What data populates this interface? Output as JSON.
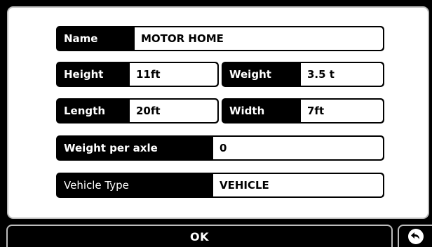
{
  "vehicle_profile": {
    "name": {
      "label": "Name",
      "value": "MOTOR HOME"
    },
    "height": {
      "label": "Height",
      "value": "11ft"
    },
    "weight": {
      "label": "Weight",
      "value": "3.5 t"
    },
    "length": {
      "label": "Length",
      "value": "20ft"
    },
    "width": {
      "label": "Width",
      "value": "7ft"
    },
    "weight_per_axle": {
      "label": "Weight per axle",
      "value": "0"
    },
    "vehicle_type": {
      "label": "Vehicle Type",
      "value": "VEHICLE"
    }
  },
  "footer": {
    "ok_label": "OK",
    "back_icon": "back-arrow-icon"
  }
}
